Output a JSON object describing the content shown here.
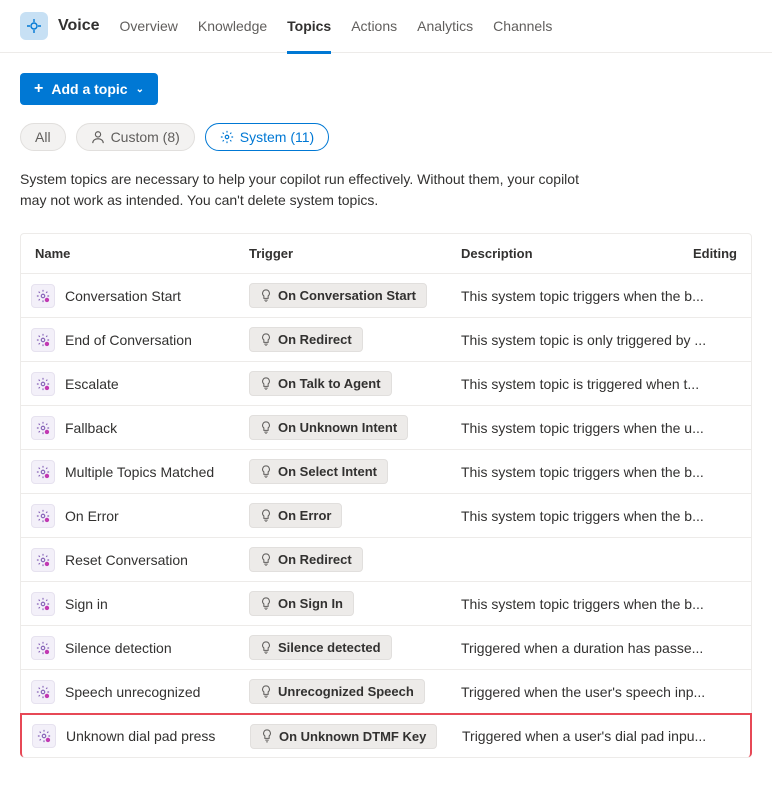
{
  "header": {
    "app_title": "Voice",
    "tabs": [
      {
        "label": "Overview",
        "active": false
      },
      {
        "label": "Knowledge",
        "active": false
      },
      {
        "label": "Topics",
        "active": true
      },
      {
        "label": "Actions",
        "active": false
      },
      {
        "label": "Analytics",
        "active": false
      },
      {
        "label": "Channels",
        "active": false
      }
    ]
  },
  "toolbar": {
    "add_topic_label": "Add a topic"
  },
  "filters": {
    "all_label": "All",
    "custom_label": "Custom (8)",
    "system_label": "System (11)"
  },
  "info_text": "System topics are necessary to help your copilot run effectively. Without them, your copilot may not work as intended. You can't delete system topics.",
  "columns": {
    "name": "Name",
    "trigger": "Trigger",
    "description": "Description",
    "editing": "Editing"
  },
  "rows": [
    {
      "name": "Conversation Start",
      "trigger": "On Conversation Start",
      "description": "This system topic triggers when the b...",
      "highlighted": false
    },
    {
      "name": "End of Conversation",
      "trigger": "On Redirect",
      "description": "This system topic is only triggered by ...",
      "highlighted": false
    },
    {
      "name": "Escalate",
      "trigger": "On Talk to Agent",
      "description": "This system topic is triggered when t...",
      "highlighted": false
    },
    {
      "name": "Fallback",
      "trigger": "On Unknown Intent",
      "description": "This system topic triggers when the u...",
      "highlighted": false
    },
    {
      "name": "Multiple Topics Matched",
      "trigger": "On Select Intent",
      "description": "This system topic triggers when the b...",
      "highlighted": false
    },
    {
      "name": "On Error",
      "trigger": "On Error",
      "description": "This system topic triggers when the b...",
      "highlighted": false
    },
    {
      "name": "Reset Conversation",
      "trigger": "On Redirect",
      "description": "",
      "highlighted": false
    },
    {
      "name": "Sign in",
      "trigger": "On Sign In",
      "description": "This system topic triggers when the b...",
      "highlighted": false
    },
    {
      "name": "Silence detection",
      "trigger": "Silence detected",
      "description": "Triggered when a duration has passe...",
      "highlighted": false
    },
    {
      "name": "Speech unrecognized",
      "trigger": "Unrecognized Speech",
      "description": "Triggered when the user's speech inp...",
      "highlighted": false
    },
    {
      "name": "Unknown dial pad press",
      "trigger": "On Unknown DTMF Key",
      "description": "Triggered when a user's dial pad inpu...",
      "highlighted": true
    }
  ]
}
